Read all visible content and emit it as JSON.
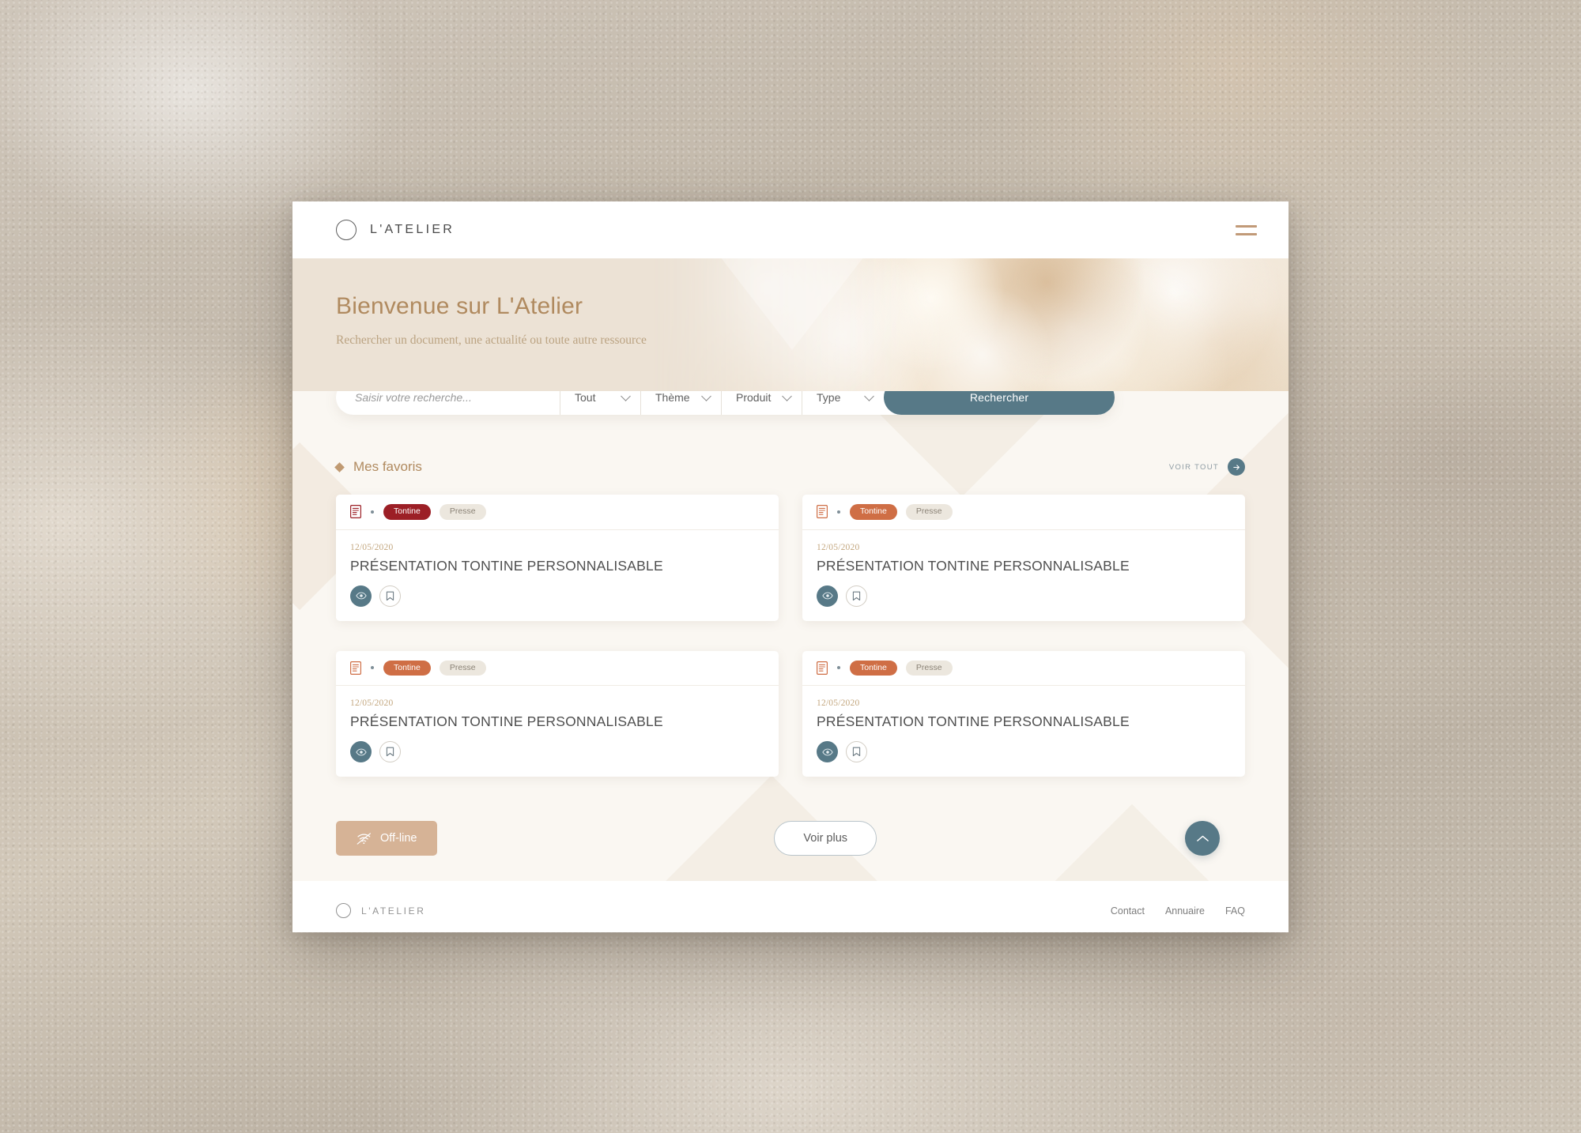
{
  "theme": {
    "teal": "#577987",
    "gold": "#b08a5f",
    "tan": "#d6b396",
    "orange": "#cf6e45",
    "darkred": "#9c1f26",
    "page_bg": "#faf7f2",
    "hero_bg": "#ece2d5"
  },
  "topbar": {
    "brand": "L'ATELIER",
    "menu_icon": "hamburger-icon"
  },
  "hero": {
    "title": "Bienvenue sur L'Atelier",
    "subtitle": "Rechercher un document, une actualité ou toute autre ressource"
  },
  "search": {
    "placeholder": "Saisir votre recherche...",
    "value": "",
    "filters": [
      {
        "name": "scope",
        "label": "Tout"
      },
      {
        "name": "theme",
        "label": "Thème"
      },
      {
        "name": "produit",
        "label": "Produit"
      },
      {
        "name": "type",
        "label": "Type"
      }
    ],
    "submit_label": "Rechercher"
  },
  "favorites": {
    "title": "Mes favoris",
    "see_all_label": "VOIR TOUT",
    "cards": [
      {
        "tag_primary": "Tontine",
        "tag_secondary": "Presse",
        "tag_color": "#9c1f26",
        "icon": "document-icon",
        "date": "12/05/2020",
        "title": "PRÉSENTATION TONTINE PERSONNALISABLE"
      },
      {
        "tag_primary": "Tontine",
        "tag_secondary": "Presse",
        "tag_color": "#cf6e45",
        "icon": "document-icon",
        "date": "12/05/2020",
        "title": "PRÉSENTATION TONTINE PERSONNALISABLE"
      },
      {
        "tag_primary": "Tontine",
        "tag_secondary": "Presse",
        "tag_color": "#cf6e45",
        "icon": "document-icon",
        "date": "12/05/2020",
        "title": "PRÉSENTATION TONTINE PERSONNALISABLE"
      },
      {
        "tag_primary": "Tontine",
        "tag_secondary": "Presse",
        "tag_color": "#cf6e45",
        "icon": "document-icon",
        "date": "12/05/2020",
        "title": "PRÉSENTATION TONTINE PERSONNALISABLE"
      }
    ]
  },
  "actions": {
    "offline_label": "Off-line",
    "offline_icon": "wifi-off-icon",
    "more_label": "Voir plus",
    "scroll_top_icon": "chevron-up-icon"
  },
  "footer": {
    "brand": "L'ATELIER",
    "links": [
      {
        "label": "Contact"
      },
      {
        "label": "Annuaire"
      },
      {
        "label": "FAQ"
      }
    ]
  }
}
